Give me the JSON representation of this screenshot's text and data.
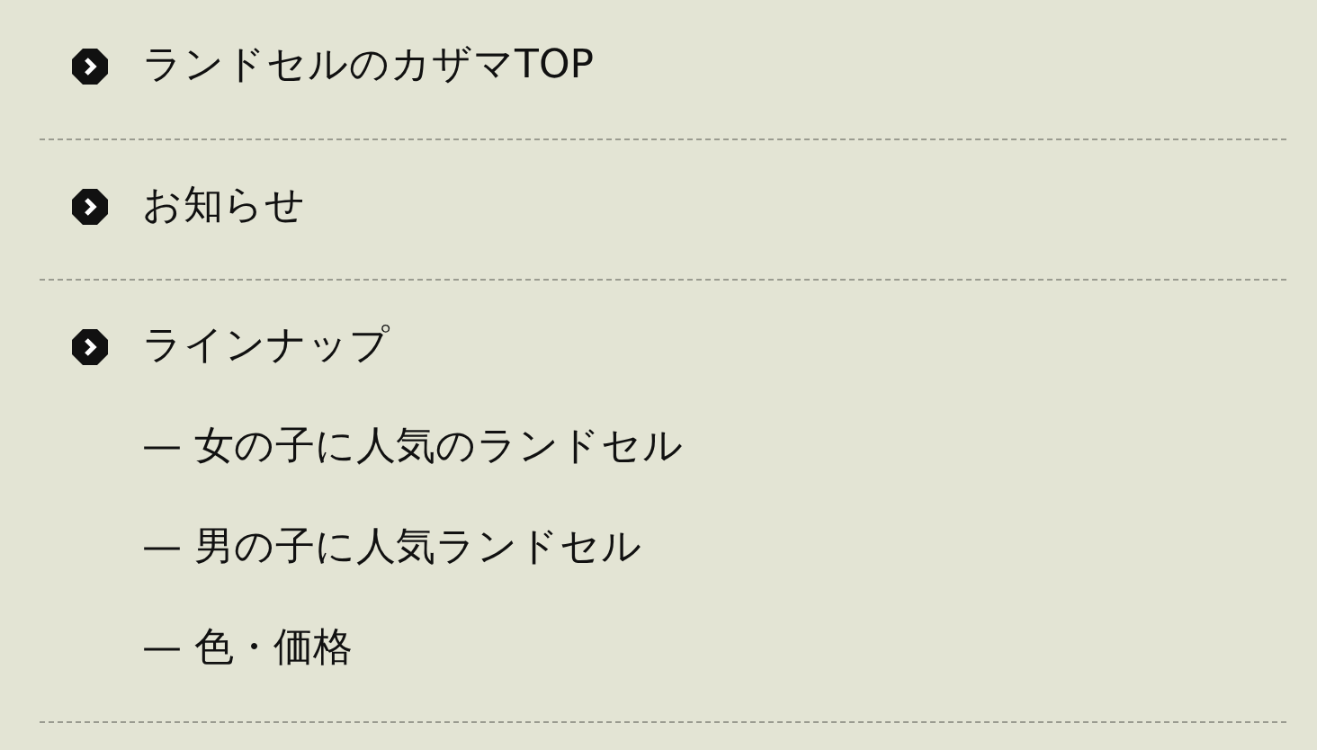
{
  "menu": [
    {
      "label": "ランドセルのカザマTOP"
    },
    {
      "label": "お知らせ"
    },
    {
      "label": "ラインナップ",
      "children": [
        {
          "label": "— 女の子に人気のランドセル"
        },
        {
          "label": "— 男の子に人気ランドセル"
        },
        {
          "label": "— 色・価格"
        }
      ]
    }
  ]
}
